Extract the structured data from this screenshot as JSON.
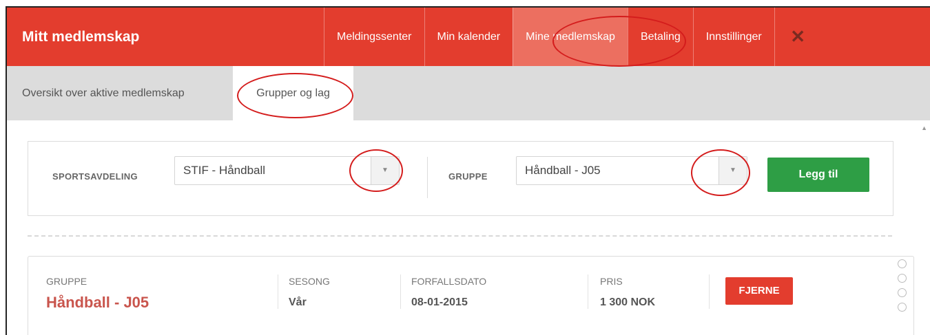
{
  "header": {
    "title": "Mitt medlemskap",
    "nav": [
      "Meldingssenter",
      "Min kalender",
      "Mine medlemskap",
      "Betaling",
      "Innstillinger"
    ],
    "active_nav": "Mine medlemskap",
    "close_glyph": "✕"
  },
  "subnav": {
    "tabs": [
      "Oversikt over aktive medlemskap",
      "Grupper og lag"
    ],
    "active_tab": "Grupper og lag"
  },
  "filter": {
    "sport_label": "SPORTSAVDELING",
    "sport_value": "STIF - Håndball",
    "group_label": "GRUPPE",
    "group_value": "Håndball - J05",
    "add_button": "Legg til",
    "arrow_glyph": "▼"
  },
  "membership": {
    "group_label": "GRUPPE",
    "group_name": "Håndball - J05",
    "season_label": "SESONG",
    "season_value": "Vår",
    "due_label": "FORFALLSDATO",
    "due_value": "08-01-2015",
    "price_label": "PRIS",
    "price_value": "1 300 NOK",
    "remove_button": "FJERNE"
  },
  "colors": {
    "accent": "#e33d2e",
    "active_nav": "#ec6f60",
    "success": "#2e9e45",
    "group_name": "#c9554d",
    "annotation": "#d41c1c"
  },
  "icons": [
    "close-icon",
    "dropdown-arrow-icon",
    "scroll-up-icon",
    "drag-handle-icon"
  ]
}
